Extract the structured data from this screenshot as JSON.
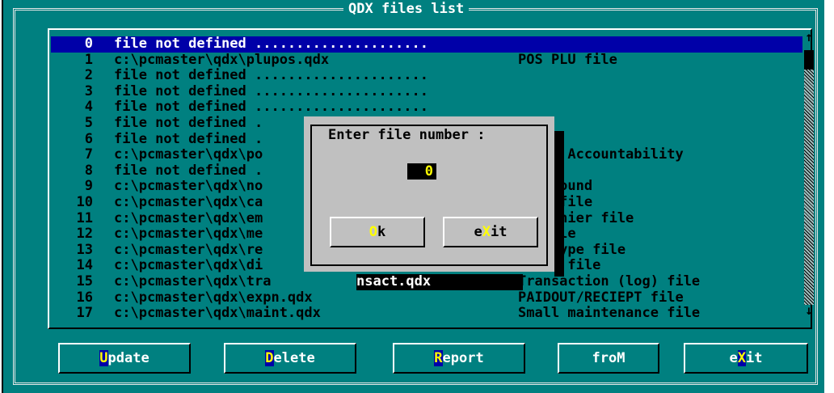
{
  "window": {
    "title": "QDX files list"
  },
  "rows": [
    {
      "num": "0",
      "path": "file not defined .....................",
      "desc": "",
      "selected": true
    },
    {
      "num": "1",
      "path": "c:\\pcmaster\\qdx\\plupos.qdx",
      "desc": "POS PLU file"
    },
    {
      "num": "2",
      "path": "file not defined .....................",
      "desc": ""
    },
    {
      "num": "3",
      "path": "file not defined .....................",
      "desc": ""
    },
    {
      "num": "4",
      "path": "file not defined .....................",
      "desc": ""
    },
    {
      "num": "5",
      "path": "file not defined .",
      "desc": ""
    },
    {
      "num": "6",
      "path": "file not defined .",
      "desc": ""
    },
    {
      "num": "7",
      "path": "c:\\pcmaster\\qdx\\po",
      "desc": "minal Accountability"
    },
    {
      "num": "8",
      "path": "file not defined .",
      "desc": ""
    },
    {
      "num": "9",
      "path": "c:\\pcmaster\\qdx\\no",
      "desc": "non found"
    },
    {
      "num": "10",
      "path": "c:\\pcmaster\\qdx\\ca",
      "desc": "hier file"
    },
    {
      "num": "11",
      "path": "c:\\pcmaster\\qdx\\em",
      "desc": "T cashier file"
    },
    {
      "num": "12",
      "path": "c:\\pcmaster\\qdx\\me",
      "desc": "ia file"
    },
    {
      "num": "13",
      "path": "c:\\pcmaster\\qdx\\re",
      "desc": "urn type file"
    },
    {
      "num": "14",
      "path": "c:\\pcmaster\\qdx\\di",
      "desc": "count file"
    },
    {
      "num": "15",
      "path": "c:\\pcmaster\\qdx\\tra",
      "path2": "nsact.qdx",
      "desc": "Transaction (log) file"
    },
    {
      "num": "16",
      "path": "c:\\pcmaster\\qdx\\expn.qdx",
      "desc": "PAIDOUT/RECIEPT file"
    },
    {
      "num": "17",
      "path": "c:\\pcmaster\\qdx\\maint.qdx",
      "desc": "Small maintenance file"
    }
  ],
  "scrollbar": {
    "up_arrow": "↑",
    "down_arrow": "↓"
  },
  "dialog": {
    "title": "Enter file number :",
    "value": "0",
    "ok": {
      "hotkey": "O",
      "rest": "k"
    },
    "exit": {
      "pre": "e",
      "hotkey": "X",
      "rest": "it"
    }
  },
  "buttons": {
    "update": {
      "hotkey": "U",
      "rest": "pdate"
    },
    "delete": {
      "hotkey": "D",
      "rest": "elete"
    },
    "report": {
      "hotkey": "R",
      "rest": "eport"
    },
    "from": {
      "label": "froM"
    },
    "exit": {
      "pre": "e",
      "hotkey": "X",
      "rest": "it"
    }
  },
  "colors": {
    "background": "#008080",
    "selection": "#0000a8",
    "hotkey": "#ffff00",
    "dialog": "#c0c0c0"
  }
}
